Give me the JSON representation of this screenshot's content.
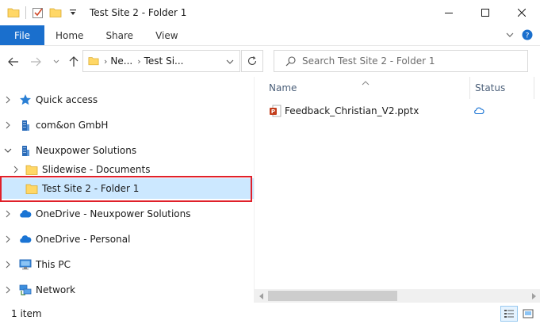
{
  "window": {
    "title": "Test Site 2 - Folder 1",
    "controls": {
      "minimize": "minimize-icon",
      "maximize": "maximize-icon",
      "close": "close-icon"
    }
  },
  "quick_access_toolbar": {
    "icons": [
      "folder-icon",
      "properties-checkbox-icon",
      "new-folder-icon",
      "customize-qat-icon"
    ]
  },
  "ribbon": {
    "file_tab": "File",
    "tabs": [
      "Home",
      "Share",
      "View"
    ],
    "accent": "#1a6fcd"
  },
  "address_bar": {
    "segments": [
      "Ne...",
      "Test Si..."
    ],
    "refresh_icon": "refresh-icon"
  },
  "search": {
    "placeholder": "Search Test Site 2 - Folder 1"
  },
  "nav_pane": {
    "items": [
      {
        "label": "Quick access",
        "icon": "star-icon",
        "expanded": false
      },
      {
        "label": "com&on GmbH",
        "icon": "building-icon",
        "expanded": false
      },
      {
        "label": "Neuxpower Solutions",
        "icon": "building-icon",
        "expanded": true
      },
      {
        "label": "Slidewise - Documents",
        "icon": "folder-icon",
        "expanded": false
      },
      {
        "label": "Test Site 2 - Folder 1",
        "icon": "folder-icon",
        "selected": true
      },
      {
        "label": "OneDrive - Neuxpower Solutions",
        "icon": "onedrive-cloud-icon",
        "expanded": false
      },
      {
        "label": "OneDrive - Personal",
        "icon": "onedrive-cloud-icon",
        "expanded": false
      },
      {
        "label": "This PC",
        "icon": "computer-icon",
        "expanded": false
      },
      {
        "label": "Network",
        "icon": "network-icon",
        "expanded": false
      }
    ],
    "selection_highlight": "#cce8ff",
    "annotation_outline": "#e0202a"
  },
  "file_list": {
    "columns": [
      "Name",
      "Status"
    ],
    "files": [
      {
        "name": "Feedback_Christian_V2.pptx",
        "icon": "powerpoint-file-icon",
        "status": "cloud-status-icon"
      }
    ]
  },
  "status_bar": {
    "item_count": "1 item"
  }
}
